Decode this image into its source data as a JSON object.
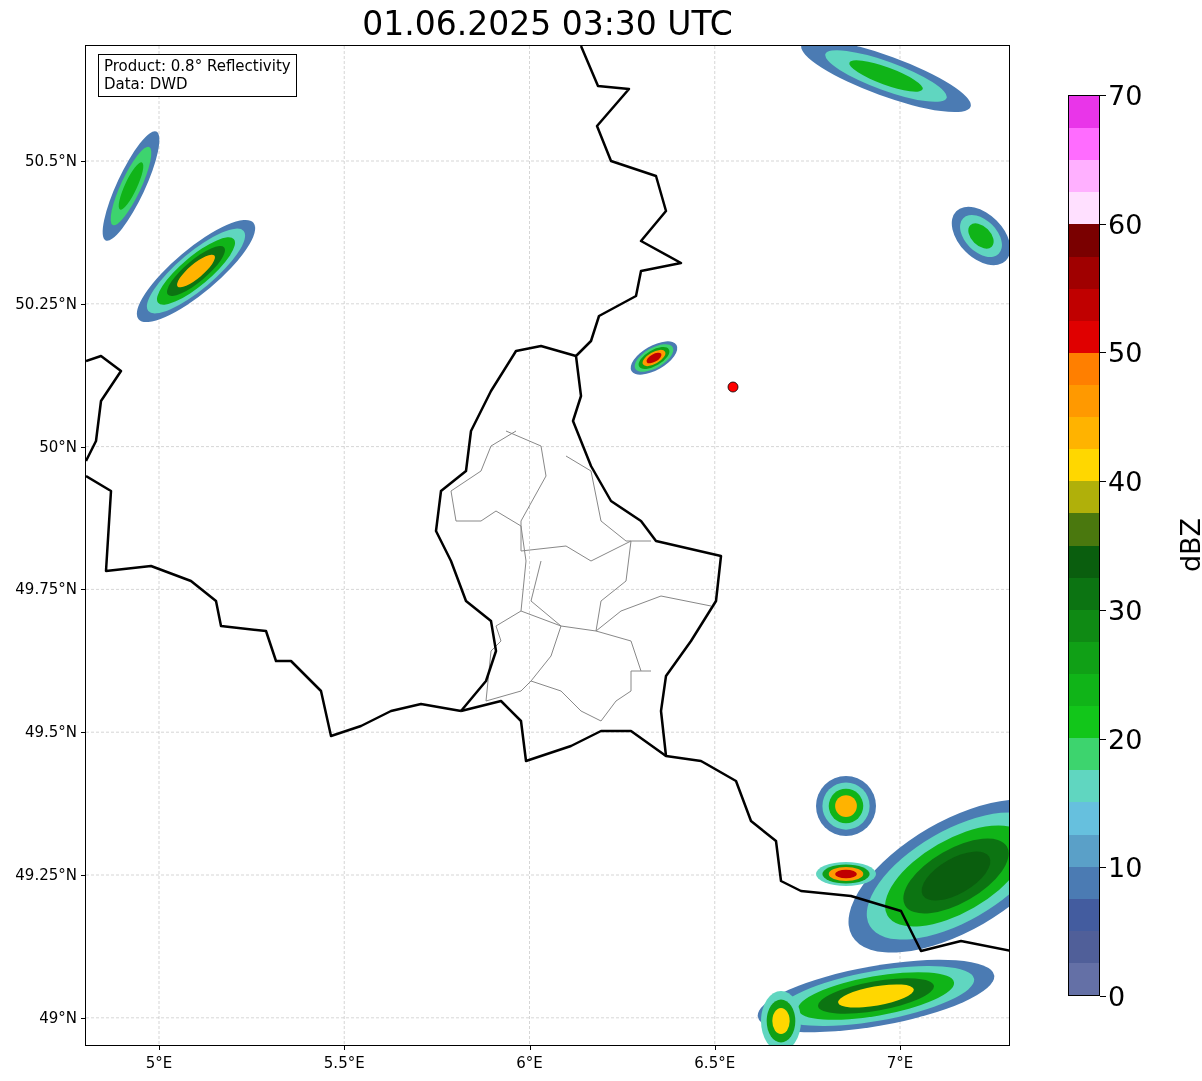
{
  "title": "01.06.2025 03:30 UTC",
  "info_box": {
    "lines": [
      "Product: 0.8° Reflectivity",
      "Data: DWD"
    ]
  },
  "map": {
    "y_ticks": [
      "50.5°N",
      "50.25°N",
      "50°N",
      "49.75°N",
      "49.5°N",
      "49.25°N",
      "49°N"
    ],
    "x_ticks": [
      "5°E",
      "5.5°E",
      "6°E",
      "6.5°E",
      "7°E"
    ]
  },
  "colorbar": {
    "label": "dBZ",
    "ticks": [
      "70",
      "60",
      "50",
      "40",
      "30",
      "20",
      "10",
      "0"
    ],
    "bins": [
      {
        "color": "#e935e9"
      },
      {
        "color": "#ff6cff"
      },
      {
        "color": "#ffb0ff"
      },
      {
        "color": "#ffe0ff"
      },
      {
        "color": "#7a0000"
      },
      {
        "color": "#a00000"
      },
      {
        "color": "#c00000"
      },
      {
        "color": "#e00000"
      },
      {
        "color": "#ff7f00"
      },
      {
        "color": "#ff9900"
      },
      {
        "color": "#ffb300"
      },
      {
        "color": "#ffd700"
      },
      {
        "color": "#b0b00a"
      },
      {
        "color": "#4a780e"
      },
      {
        "color": "#0a5e0e"
      },
      {
        "color": "#0c7412"
      },
      {
        "color": "#0f8a14"
      },
      {
        "color": "#10a016"
      },
      {
        "color": "#10b418"
      },
      {
        "color": "#12c61a"
      },
      {
        "color": "#3dd46e"
      },
      {
        "color": "#60d6c0"
      },
      {
        "color": "#66c0de"
      },
      {
        "color": "#5aa0c8"
      },
      {
        "color": "#4b7bb3"
      },
      {
        "color": "#435c9f"
      },
      {
        "color": "#505f99"
      },
      {
        "color": "#6470a6"
      }
    ]
  }
}
